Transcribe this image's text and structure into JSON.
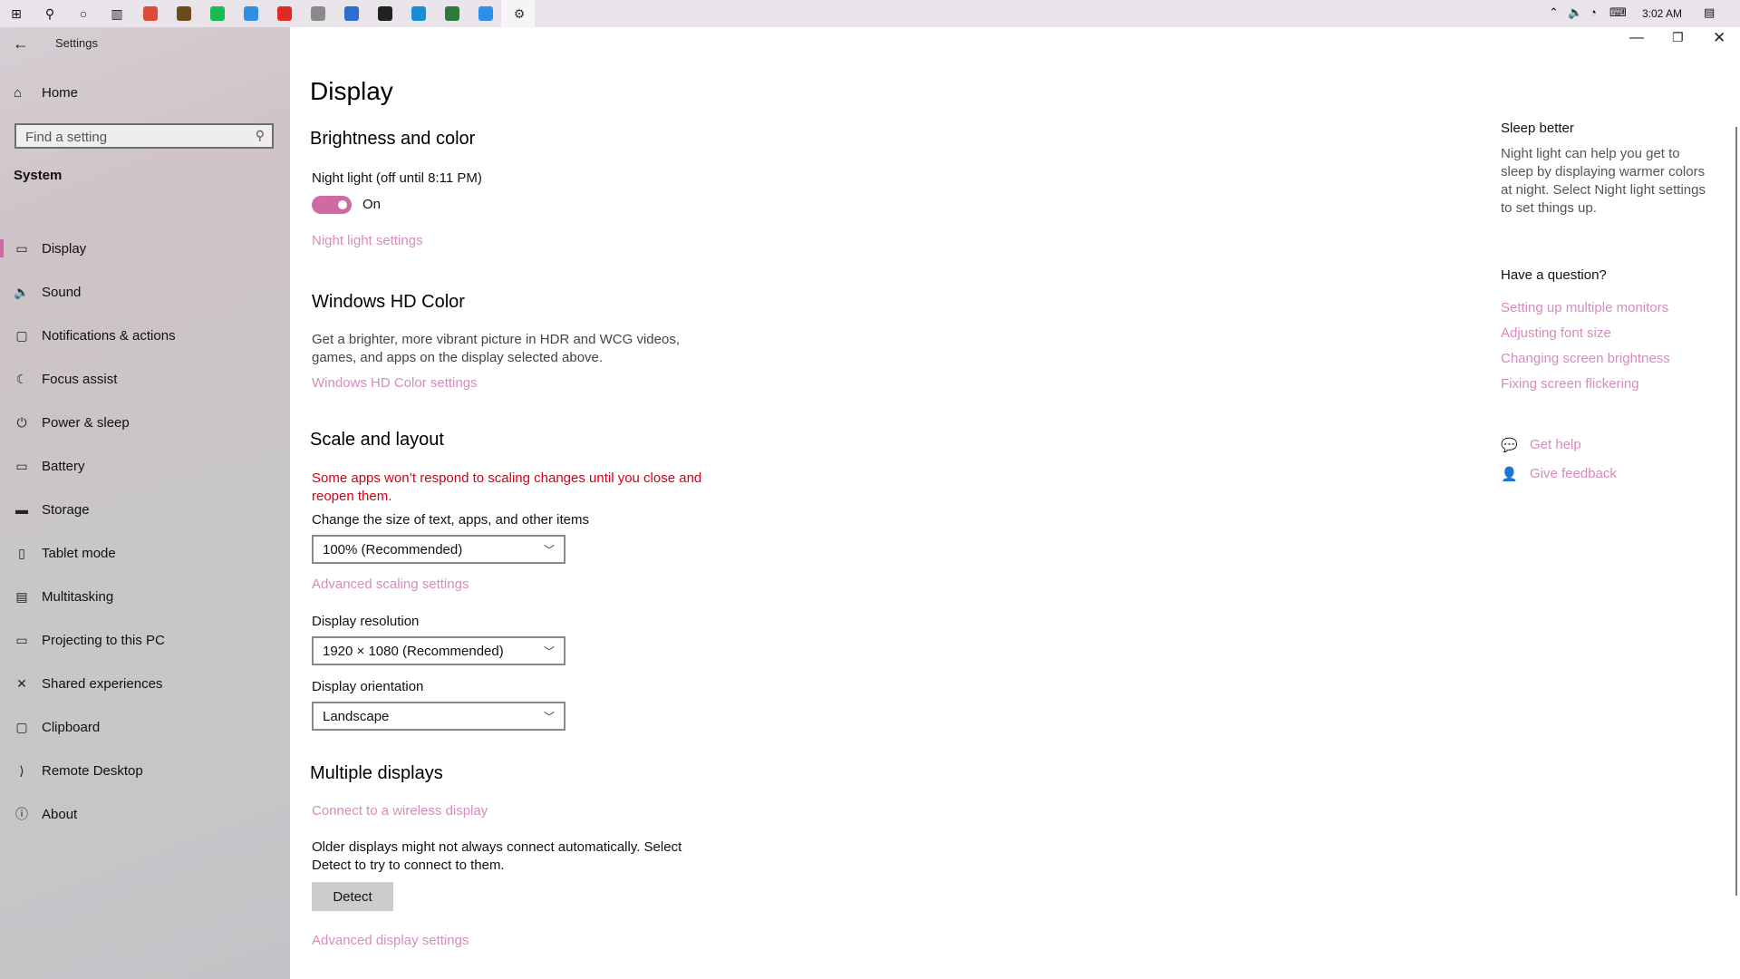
{
  "taskbar": {
    "clock": "3:02 AM",
    "apps": [
      {
        "icon": "windows-start-icon",
        "color": "#111111"
      },
      {
        "icon": "search-icon",
        "color": "#111111"
      },
      {
        "icon": "cortana-icon",
        "color": "#111111"
      },
      {
        "icon": "task-view-icon",
        "color": "#111111"
      },
      {
        "icon": "chrome-icon",
        "color": "#e04a3a"
      },
      {
        "icon": "minecraft-icon",
        "color": "#6b4a1e"
      },
      {
        "icon": "spotify-icon",
        "color": "#1db954"
      },
      {
        "icon": "app-icon",
        "color": "#2d8fe8"
      },
      {
        "icon": "app-icon",
        "color": "#e02a2a"
      },
      {
        "icon": "app-icon",
        "color": "#8a8a8a"
      },
      {
        "icon": "app-icon",
        "color": "#2b6fcf"
      },
      {
        "icon": "obs-icon",
        "color": "#222222"
      },
      {
        "icon": "edge-icon",
        "color": "#1b8bd6"
      },
      {
        "icon": "app-icon",
        "color": "#2e7a3a"
      },
      {
        "icon": "app-icon",
        "color": "#2d8fe8"
      },
      {
        "icon": "settings-icon",
        "color": "#333333"
      }
    ]
  },
  "window": {
    "title": "Settings"
  },
  "sidebar": {
    "home_label": "Home",
    "search_placeholder": "Find a setting",
    "category": "System",
    "items": [
      {
        "label": "Display",
        "icon": "monitor-icon",
        "glyph": "▭"
      },
      {
        "label": "Sound",
        "icon": "speaker-icon",
        "glyph": "🔈"
      },
      {
        "label": "Notifications & actions",
        "icon": "notifications-icon",
        "glyph": "▢"
      },
      {
        "label": "Focus assist",
        "icon": "moon-icon",
        "glyph": "☾"
      },
      {
        "label": "Power & sleep",
        "icon": "power-icon",
        "glyph": "⏻"
      },
      {
        "label": "Battery",
        "icon": "battery-icon",
        "glyph": "▭"
      },
      {
        "label": "Storage",
        "icon": "storage-icon",
        "glyph": "▬"
      },
      {
        "label": "Tablet mode",
        "icon": "tablet-icon",
        "glyph": "▯"
      },
      {
        "label": "Multitasking",
        "icon": "multitasking-icon",
        "glyph": "▤"
      },
      {
        "label": "Projecting to this PC",
        "icon": "projecting-icon",
        "glyph": "▭"
      },
      {
        "label": "Shared experiences",
        "icon": "shared-icon",
        "glyph": "✕"
      },
      {
        "label": "Clipboard",
        "icon": "clipboard-icon",
        "glyph": "▢"
      },
      {
        "label": "Remote Desktop",
        "icon": "remote-desktop-icon",
        "glyph": "⟩"
      },
      {
        "label": "About",
        "icon": "info-icon",
        "glyph": "ⓘ"
      }
    ]
  },
  "main": {
    "title": "Display",
    "brightness": {
      "heading": "Brightness and color",
      "night_light_label": "Night light (off until 8:11 PM)",
      "toggle_state": "On",
      "night_light_link": "Night light settings"
    },
    "hdr": {
      "heading": "Windows HD Color",
      "description": "Get a brighter, more vibrant picture in HDR and WCG videos, games, and apps on the display selected above.",
      "link": "Windows HD Color settings"
    },
    "scale": {
      "heading": "Scale and layout",
      "warning": "Some apps won’t respond to scaling changes until you close and reopen them.",
      "size_label": "Change the size of text, apps, and other items",
      "size_value": "100% (Recommended)",
      "advanced_link": "Advanced scaling settings",
      "resolution_label": "Display resolution",
      "resolution_value": "1920 × 1080 (Recommended)",
      "orientation_label": "Display orientation",
      "orientation_value": "Landscape"
    },
    "multiple": {
      "heading": "Multiple displays",
      "connect_link": "Connect to a wireless display",
      "description": "Older displays might not always connect automatically. Select Detect to try to connect to them.",
      "detect_label": "Detect",
      "advanced_link": "Advanced display settings"
    }
  },
  "right_panel": {
    "sleep_heading": "Sleep better",
    "sleep_text": "Night light can help you get to sleep by displaying warmer colors at night. Select Night light settings to set things up.",
    "question_heading": "Have a question?",
    "links": [
      "Setting up multiple monitors",
      "Adjusting font size",
      "Changing screen brightness",
      "Fixing screen flickering"
    ],
    "get_help": "Get help",
    "give_feedback": "Give feedback"
  },
  "colors": {
    "accent": "#cf6aa4",
    "link": "#d98bbc",
    "warning": "#d0021b"
  }
}
